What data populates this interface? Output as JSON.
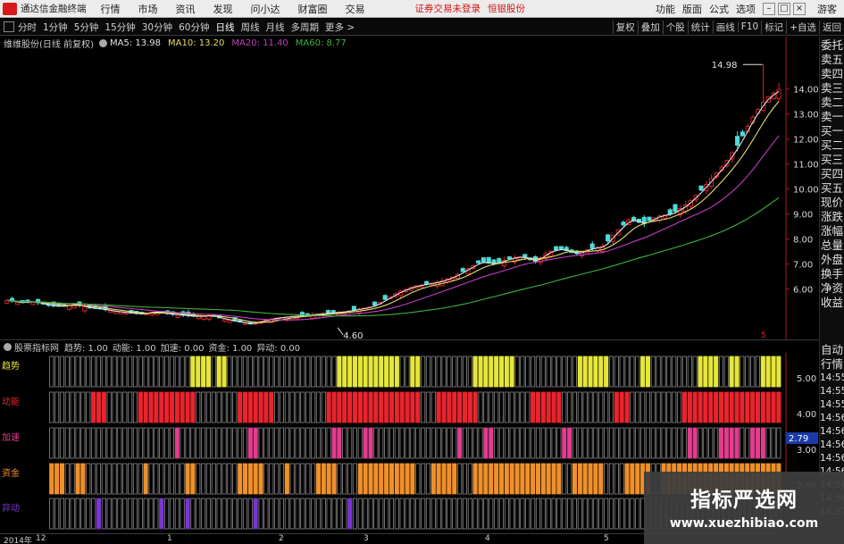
{
  "menubar": {
    "app_name": "通达信金融终端",
    "items": [
      "行情",
      "市场",
      "资讯",
      "发现",
      "问小达",
      "财富圈",
      "交易"
    ],
    "notice": "证券交易未登录",
    "notice2": "恒银股份",
    "right_items": [
      "功能",
      "版面",
      "公式",
      "选项"
    ],
    "guest": "游客"
  },
  "periodbar": {
    "periods": [
      "分时",
      "1分钟",
      "5分钟",
      "15分钟",
      "30分钟",
      "60分钟",
      "日线",
      "周线",
      "月线",
      "多周期",
      "更多 >"
    ],
    "active": "日线",
    "tools": [
      "复权",
      "叠加",
      "个股",
      "统计",
      "画线",
      "F10",
      "标记",
      "+自选",
      "返回"
    ]
  },
  "chart": {
    "stock_label": "维维股份(日线 前复权)",
    "ma5_label": "MA5: 13.98",
    "ma10_label": "MA10: 13.20",
    "ma20_label": "MA20: 11.40",
    "ma60_label": "MA60: 8.77",
    "high_label": "14.98",
    "low_label": "4.60",
    "marker_label": "5",
    "colors": {
      "up": "#e8252d",
      "down": "#4fd9d9",
      "ma5": "#e0e0e0",
      "ma10": "#e6dc6a",
      "ma20": "#c23ec2",
      "ma60": "#3cb43c"
    }
  },
  "sidebar": {
    "items": [
      "委托",
      "卖五",
      "卖四",
      "卖三",
      "卖二",
      "卖一",
      "买一",
      "买二",
      "买三",
      "买四",
      "买五",
      "现价",
      "涨跌",
      "涨幅",
      "总量",
      "外盘",
      "换手",
      "净资",
      "收益"
    ]
  },
  "indicator": {
    "source_label": "股票指标网",
    "kvs": [
      {
        "label": "趋势: 1.00",
        "color": "#e6e63a"
      },
      {
        "label": "动能: 1.00",
        "color": "#e8252d"
      },
      {
        "label": "加速: 0.00",
        "color": "#e33d8f"
      },
      {
        "label": "资金: 1.00",
        "color": "#f0902a"
      },
      {
        "label": "异动: 0.00",
        "color": "#7a35d4"
      }
    ],
    "row_labels": [
      "趋势",
      "动能",
      "加速",
      "资金",
      "异动"
    ],
    "scale_labels": [
      "5.00",
      "4.00",
      "3.00",
      "2.00"
    ],
    "last_value": "2.79",
    "sidebar_items": [
      "自动",
      "行情"
    ],
    "times": [
      "14:55",
      "14:55",
      "14:55",
      "14:56",
      "14:56",
      "14:56",
      "14:56",
      "14:56",
      "14:56",
      "14:56",
      "14:57"
    ]
  },
  "datebar": {
    "labels": [
      "2014年",
      "12",
      "1",
      "2",
      "3",
      "4",
      "5"
    ]
  },
  "watermark": {
    "line1": "指标严选网",
    "line2": "www.xuezhibiao.com"
  },
  "chart_data": {
    "type": "candlestick",
    "title": "维维股份(日线 前复权)",
    "ylim": [
      4.6,
      14.98
    ],
    "y_ticks": [
      6.0,
      7.0,
      8.0,
      9.0,
      10.0,
      11.0,
      12.0,
      13.0,
      14.0
    ],
    "y_tick_labels": [
      "6.00",
      "7.00",
      "8.00",
      "9.00",
      "10.00",
      "11.00",
      "12.00",
      "13.00",
      "14.00"
    ],
    "x_labels": [
      "2014年12",
      "1",
      "2",
      "3",
      "4",
      "5"
    ],
    "high": 14.98,
    "low": 4.6,
    "series": [
      {
        "name": "MA5",
        "last": 13.98
      },
      {
        "name": "MA10",
        "last": 13.2
      },
      {
        "name": "MA20",
        "last": 11.4
      },
      {
        "name": "MA60",
        "last": 8.77
      }
    ],
    "close_path": [
      5.55,
      5.45,
      5.5,
      5.35,
      5.3,
      5.4,
      5.25,
      5.2,
      5.1,
      5.05,
      5.0,
      5.1,
      5.0,
      4.95,
      4.9,
      4.95,
      4.8,
      4.7,
      4.6,
      4.75,
      4.85,
      4.9,
      4.95,
      5.0,
      5.05,
      5.1,
      5.2,
      5.3,
      5.6,
      5.9,
      6.1,
      6.2,
      6.3,
      6.5,
      6.8,
      7.1,
      7.0,
      7.2,
      7.3,
      7.1,
      7.5,
      7.6,
      7.4,
      7.6,
      7.7,
      8.3,
      8.8,
      8.6,
      8.9,
      9.0,
      9.3,
      9.8,
      10.4,
      11.0,
      11.8,
      12.8,
      13.6,
      13.98
    ]
  }
}
